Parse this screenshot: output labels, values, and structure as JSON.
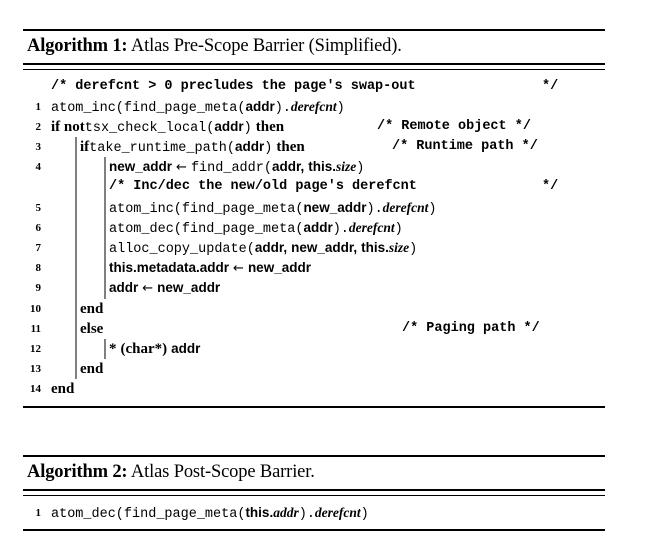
{
  "algorithms": [
    {
      "id": "algorithm-1",
      "label": "Algorithm 1:",
      "title": "Atlas Pre-Scope Barrier (Simplified).",
      "lines": [
        {
          "n": "",
          "text": "/* derefcnt > 0 precludes the page's swap-out        */"
        },
        {
          "n": "1",
          "text": "atom_inc(find_page_meta(addr).derefcnt)"
        },
        {
          "n": "2",
          "text": "if not tsx_check_local(addr) then",
          "comment": "/* Remote object */"
        },
        {
          "n": "3",
          "text": "if take_runtime_path(addr) then",
          "comment": "/* Runtime path */"
        },
        {
          "n": "4",
          "text": "new_addr ← find_addr(addr, this.size)"
        },
        {
          "n": "",
          "text": "/* Inc/dec the new/old page's derefcnt        */"
        },
        {
          "n": "5",
          "text": "atom_inc(find_page_meta(new_addr).derefcnt)"
        },
        {
          "n": "6",
          "text": "atom_dec(find_page_meta(addr).derefcnt)"
        },
        {
          "n": "7",
          "text": "alloc_copy_update(addr, new_addr, this.size)"
        },
        {
          "n": "8",
          "text": "this.metadata.addr ← new_addr"
        },
        {
          "n": "9",
          "text": "addr ← new_addr"
        },
        {
          "n": "10",
          "text": "end"
        },
        {
          "n": "11",
          "text": "else",
          "comment": "/* Paging path */"
        },
        {
          "n": "12",
          "text": "* (char*) addr"
        },
        {
          "n": "13",
          "text": "end"
        },
        {
          "n": "14",
          "text": "end"
        }
      ]
    },
    {
      "id": "algorithm-2",
      "label": "Algorithm 2:",
      "title": "Atlas Post-Scope Barrier.",
      "lines": [
        {
          "n": "1",
          "text": "atom_dec(find_page_meta(this.addr).derefcnt)"
        }
      ]
    }
  ],
  "alg1": {
    "label": "Algorithm 1:",
    "title": "Atlas Pre-Scope Barrier (Simplified).",
    "l0": {
      "n": "",
      "c": "/* derefcnt > 0 precludes the page's swap-out",
      "ce": "*/"
    },
    "l1": {
      "n": "1",
      "a": "atom_inc(find_page_meta(",
      "b": "addr",
      "c": ").",
      "d": "derefcnt",
      "e": ")"
    },
    "l2": {
      "n": "2",
      "kw1": "if not",
      "a": "tsx_check_local(",
      "b": "addr",
      "c": ")",
      "kw2": "then",
      "cmt": "/* Remote object */"
    },
    "l3": {
      "n": "3",
      "kw1": "if",
      "a": "take_runtime_path(",
      "b": "addr",
      "c": ")",
      "kw2": "then",
      "cmt": "/* Runtime path */"
    },
    "l4": {
      "n": "4",
      "b": "new_addr",
      "arrow": "←",
      "a": "find_addr(",
      "b2": "addr",
      "comma": ",",
      "b3": "this.",
      "d": "size",
      "c": ")"
    },
    "l5": {
      "n": "",
      "c": "/* Inc/dec the new/old page's derefcnt",
      "ce": "*/"
    },
    "l6": {
      "n": "5",
      "a": "atom_inc(find_page_meta(",
      "b": "new_addr",
      "c": ").",
      "d": "derefcnt",
      "e": ")"
    },
    "l7": {
      "n": "6",
      "a": "atom_dec(find_page_meta(",
      "b": "addr",
      "c": ").",
      "d": "derefcnt",
      "e": ")"
    },
    "l8": {
      "n": "7",
      "a": "alloc_copy_update(",
      "b": "addr",
      "comma": ",",
      "b2": "new_addr",
      "comma2": ",",
      "b3": "this.",
      "d": "size",
      "c": ")"
    },
    "l9": {
      "n": "8",
      "b": "this.metadata.addr",
      "arrow": "←",
      "b2": "new_addr"
    },
    "l10": {
      "n": "9",
      "b": "addr",
      "arrow": "←",
      "b2": "new_addr"
    },
    "l11": {
      "n": "10",
      "kw": "end"
    },
    "l12": {
      "n": "11",
      "kw": "else",
      "cmt": "/* Paging path */"
    },
    "l13": {
      "n": "12",
      "star": "*",
      "cast": "(char*)",
      "b": "addr"
    },
    "l14": {
      "n": "13",
      "kw": "end"
    },
    "l15": {
      "n": "14",
      "kw": "end"
    }
  },
  "alg2": {
    "label": "Algorithm 2:",
    "title": "Atlas Post-Scope Barrier.",
    "l1": {
      "n": "1",
      "a": "atom_dec(find_page_meta(",
      "b": "this.",
      "d": "addr",
      "c": ").",
      "d2": "derefcnt",
      "e": ")"
    }
  },
  "colors": {
    "rule": "#000000",
    "guide": "#808080",
    "text": "#000000",
    "background": "#ffffff"
  }
}
